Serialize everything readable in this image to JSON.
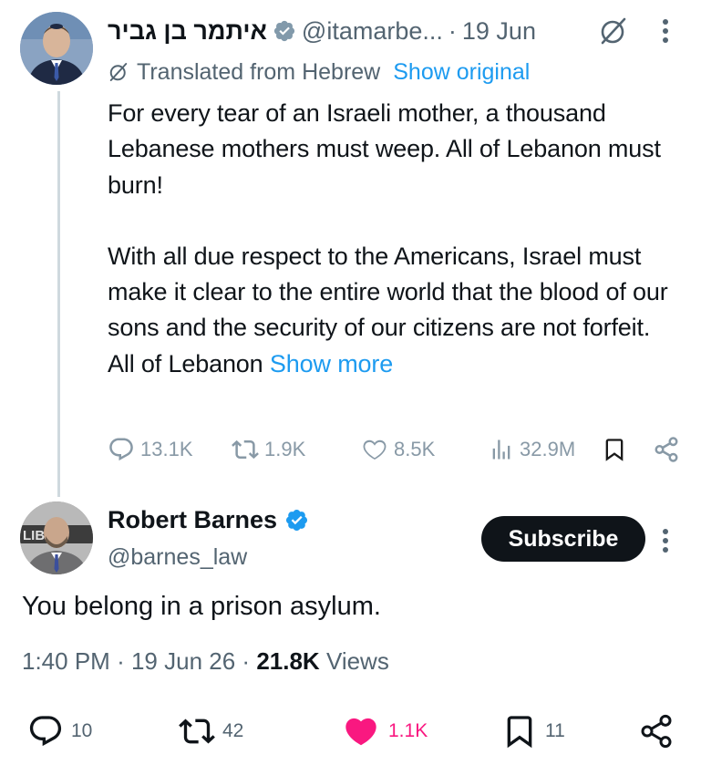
{
  "parent_tweet": {
    "display_name": "איתמר בן גביר",
    "handle": "@itamarbe...",
    "separator": "·",
    "date": "19 Jun",
    "translated_label": "Translated from Hebrew",
    "show_original_label": "Show original",
    "paragraph_1": "For every tear of an Israeli mother, a thousand Lebanese mothers must weep. All of Lebanon must burn!",
    "paragraph_2": "With all due respect to the Americans, Israel must make it clear to the entire world that the blood of our sons and the security of our citizens are not forfeit. All of Lebanon",
    "show_more_label": "Show more",
    "actions": {
      "replies": "13.1K",
      "reposts": "1.9K",
      "likes": "8.5K",
      "views": "32.9M"
    },
    "icons": [
      "avatar",
      "verified-badge-icon",
      "grok-icon",
      "more-icon",
      "reply-icon",
      "repost-icon",
      "like-icon",
      "views-icon",
      "bookmark-icon",
      "share-icon"
    ]
  },
  "reply_tweet": {
    "display_name": "Robert Barnes",
    "handle": "@barnes_law",
    "subscribe_label": "Subscribe",
    "text": "You belong in a prison asylum.",
    "time": "1:40 PM",
    "meta_separator": "·",
    "date": "19 Jun 26",
    "views_count": "21.8K",
    "views_label": "Views",
    "avatar_logo_text": "LIBWO",
    "actions": {
      "replies": "10",
      "reposts": "42",
      "likes": "1.1K",
      "bookmarks": "11"
    }
  },
  "colors": {
    "text": "#0f1419",
    "secondary": "#536471",
    "link_blue": "#1d9bf0",
    "verified_blue": "#1d9bf0",
    "like_pink": "#f91880",
    "subscribe_bg": "#0f1419"
  }
}
